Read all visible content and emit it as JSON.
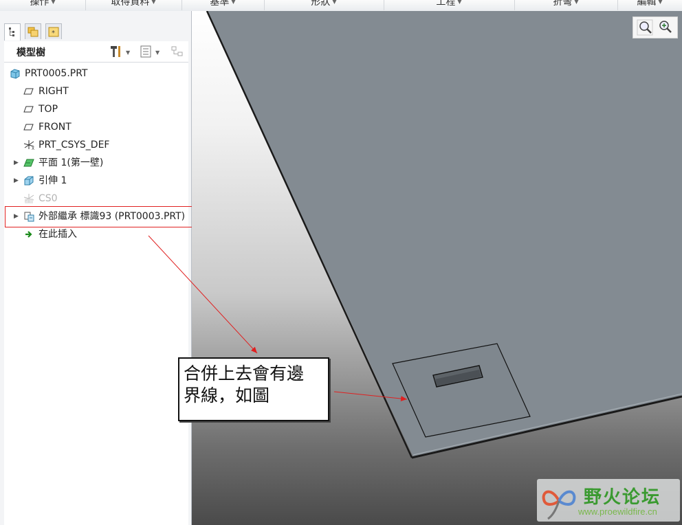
{
  "menu": {
    "items": [
      {
        "label": "操作"
      },
      {
        "label": "取得資料"
      },
      {
        "label": "基準"
      },
      {
        "label": "形狀"
      },
      {
        "label": "工程"
      },
      {
        "label": "折彎"
      },
      {
        "label": "編輯"
      }
    ]
  },
  "model_tree": {
    "title": "模型樹",
    "items": [
      {
        "label": "PRT0005.PRT",
        "icon": "part-icon"
      },
      {
        "label": "RIGHT",
        "icon": "datum-plane-icon"
      },
      {
        "label": "TOP",
        "icon": "datum-plane-icon"
      },
      {
        "label": "FRONT",
        "icon": "datum-plane-icon"
      },
      {
        "label": "PRT_CSYS_DEF",
        "icon": "csys-icon"
      },
      {
        "label": "平面 1(第一壁)",
        "icon": "flat-wall-icon"
      },
      {
        "label": "引伸 1",
        "icon": "extrude-icon"
      },
      {
        "label": "CS0",
        "icon": "csys-icon"
      },
      {
        "label": "外部繼承 標識93 (PRT0003.PRT)",
        "icon": "external-inheritance-icon"
      },
      {
        "label": "在此插入",
        "icon": "insert-here-arrow-icon"
      }
    ]
  },
  "callout": {
    "line1": "合併上去會有邊",
    "line2": "界線，如圖"
  },
  "watermark": {
    "name": "野火论坛",
    "url": "www.proewildfire.cn"
  },
  "colors": {
    "annotation_red": "#e02020",
    "sheet_metal": "#838b92",
    "tree_highlight_box": "#e02020"
  }
}
